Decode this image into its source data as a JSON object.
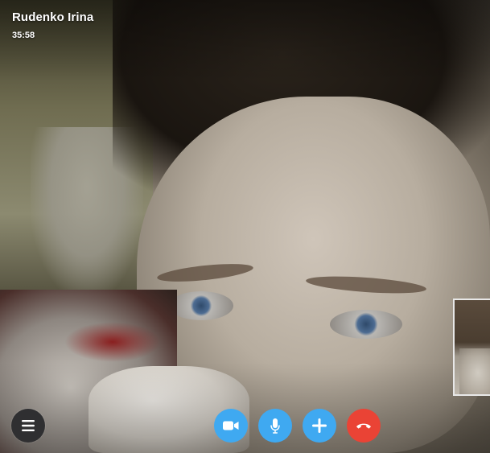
{
  "call": {
    "contact_name": "Rudenko Irina",
    "duration": "35:58"
  },
  "controls": {
    "menu_icon": "hamburger-menu-icon",
    "video_icon": "video-camera-icon",
    "mic_icon": "microphone-icon",
    "add_icon": "plus-icon",
    "end_icon": "hang-up-icon"
  },
  "colors": {
    "primary_button": "#3fa9f1",
    "end_call_button": "#ea4335",
    "menu_button": "#2f2f31",
    "text": "#ffffff"
  }
}
